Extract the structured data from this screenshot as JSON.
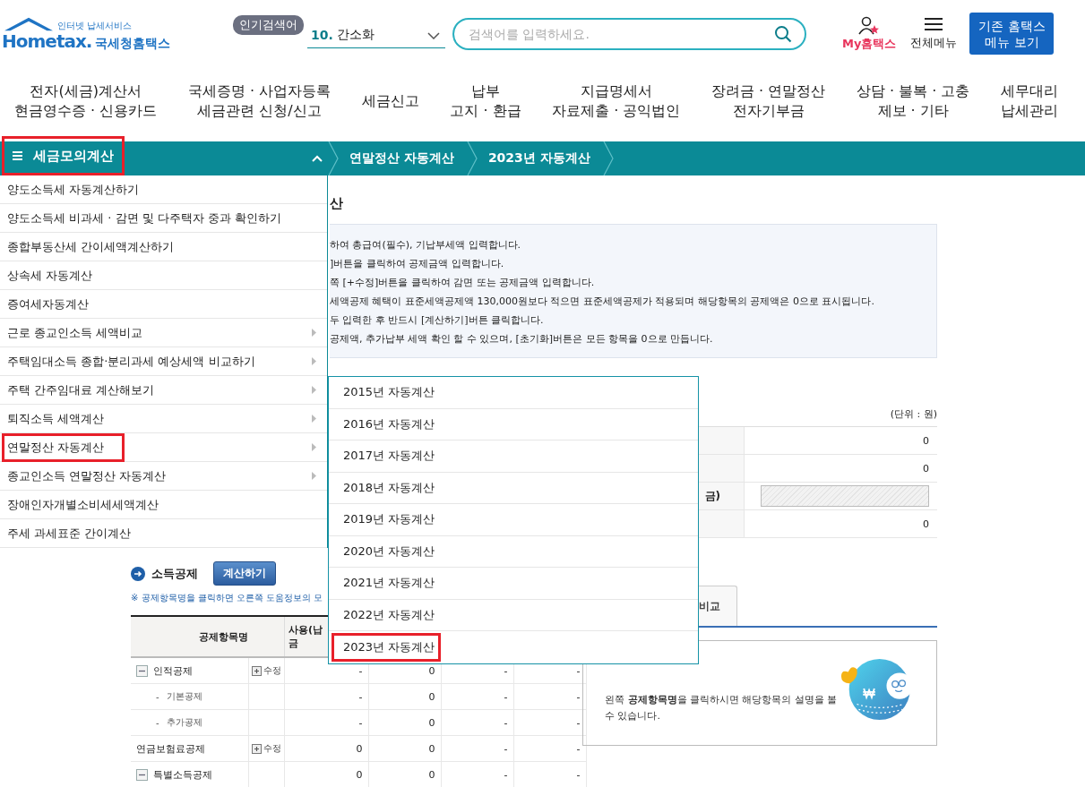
{
  "header": {
    "logo_tagline": "인터넷 납세서비스",
    "logo_text": "Hometax.",
    "logo_name": "국세청홈택스",
    "popular_label": "인기검색어",
    "popular_rank": "10.",
    "popular_term": "간소화",
    "search_placeholder": "검색어를 입력하세요.",
    "my_label": "My홈택스",
    "menu_label": "전체메뉴",
    "legacy_button": [
      "기존 홈택스",
      "메뉴 보기"
    ]
  },
  "nav": [
    {
      "lines": [
        "전자(세금)계산서",
        "현금영수증 · 신용카드"
      ]
    },
    {
      "lines": [
        "국세증명 · 사업자등록",
        "세금관련 신청/신고"
      ]
    },
    {
      "lines": [
        "세금신고"
      ]
    },
    {
      "lines": [
        "납부",
        "고지 · 환급"
      ]
    },
    {
      "lines": [
        "지급명세서",
        "자료제출 · 공익법인"
      ]
    },
    {
      "lines": [
        "장려금 · 연말정산",
        "전자기부금"
      ]
    },
    {
      "lines": [
        "상담 · 불복 · 고충",
        "제보 · 기타"
      ]
    },
    {
      "lines": [
        "세무대리",
        "납세관리"
      ]
    }
  ],
  "bar": {
    "menu_title": "세금모의계산",
    "highlighted": true,
    "expanded": true,
    "breadcrumbs": [
      "연말정산 자동계산",
      "2023년 자동계산"
    ]
  },
  "side_menu": [
    {
      "label": "양도소득세 자동계산하기",
      "has_submenu": false,
      "highlighted": false
    },
    {
      "label": "양도소득세 비과세 · 감면 및 다주택자 중과 확인하기",
      "has_submenu": false,
      "highlighted": false
    },
    {
      "label": "종합부동산세 간이세액계산하기",
      "has_submenu": false,
      "highlighted": false
    },
    {
      "label": "상속세 자동계산",
      "has_submenu": false,
      "highlighted": false
    },
    {
      "label": "증여세자동계산",
      "has_submenu": false,
      "highlighted": false
    },
    {
      "label": "근로 종교인소득 세액비교",
      "has_submenu": true,
      "highlighted": false
    },
    {
      "label": "주택임대소득 종합·분리과세 예상세액 비교하기",
      "has_submenu": true,
      "highlighted": false
    },
    {
      "label": "주택 간주임대료 계산해보기",
      "has_submenu": true,
      "highlighted": false
    },
    {
      "label": "퇴직소득 세액계산",
      "has_submenu": true,
      "highlighted": false
    },
    {
      "label": "연말정산 자동계산",
      "has_submenu": true,
      "highlighted": true
    },
    {
      "label": "종교인소득 연말정산 자동계산",
      "has_submenu": true,
      "highlighted": false
    },
    {
      "label": "장애인자개별소비세세액계산",
      "has_submenu": false,
      "highlighted": false
    },
    {
      "label": "주세 과세표준 간이계산",
      "has_submenu": false,
      "highlighted": false
    }
  ],
  "submenu": [
    {
      "label": "2015년 자동계산",
      "highlighted": false
    },
    {
      "label": "2016년 자동계산",
      "highlighted": false
    },
    {
      "label": "2017년 자동계산",
      "highlighted": false
    },
    {
      "label": "2018년 자동계산",
      "highlighted": false
    },
    {
      "label": "2019년 자동계산",
      "highlighted": false
    },
    {
      "label": "2020년 자동계산",
      "highlighted": false
    },
    {
      "label": "2021년 자동계산",
      "highlighted": false
    },
    {
      "label": "2022년 자동계산",
      "highlighted": false
    },
    {
      "label": "2023년 자동계산",
      "highlighted": true
    }
  ],
  "page": {
    "title": "산",
    "notes": [
      "하여 총급여(필수), 기납부세액 입력합니다.",
      "]버튼을 클릭하여 공제금액 입력합니다.",
      "쪽 [+수정]버튼을 클릭하여 감면 또는 공제금액 입력합니다.",
      "세액공제 혜택이 표준세액공제액 130,000원보다 적으면 표준세액공제가 적용되며 해당항목의 공제액은 0으로 표시됩니다.",
      "두 입력한 후 반드시 [계산하기]버튼 클릭합니다.",
      "공제액, 추가납부 세액 확인 할 수 있으며, [초기화]버튼은 모든 항목을 0으로 만듭니다."
    ],
    "unit": "(단위 : 원)",
    "summary": [
      {
        "kind": "value",
        "value": "0"
      },
      {
        "kind": "value",
        "value": "0"
      },
      {
        "kind": "input",
        "label": "금)",
        "disabled": true
      },
      {
        "kind": "value",
        "value": "0"
      }
    ]
  },
  "deduction": {
    "title": "소득공제",
    "calc_button": "계산하기",
    "note": "※ 공제항목명을 클릭하면 오른쪽 도움정보의 모",
    "columns": [
      "공제항목명",
      "",
      "사용(납\n금"
    ],
    "rows": [
      {
        "kind": "group",
        "expanded": true,
        "cells": [
          "인적공제",
          "수정",
          "-",
          "0",
          "-",
          "-"
        ],
        "children": [
          {
            "marker": "-",
            "cells": [
              "기본공제",
              "",
              "-",
              "0",
              "-",
              "-"
            ]
          },
          {
            "marker": "-",
            "cells": [
              "추가공제",
              "",
              "-",
              "0",
              "-",
              "-"
            ]
          }
        ]
      },
      {
        "kind": "item",
        "cells": [
          "연금보험료공제",
          "수정",
          "0",
          "0",
          "-",
          "-"
        ]
      },
      {
        "kind": "group",
        "expanded": true,
        "cells": [
          "특별소득공제",
          "",
          "0",
          "0",
          "-",
          "-"
        ]
      }
    ]
  },
  "help": {
    "tab": "비교",
    "text": "왼쪽 **공제항목명**을 클릭하시면 해당항목의 설명을 볼 수 있습니다."
  }
}
